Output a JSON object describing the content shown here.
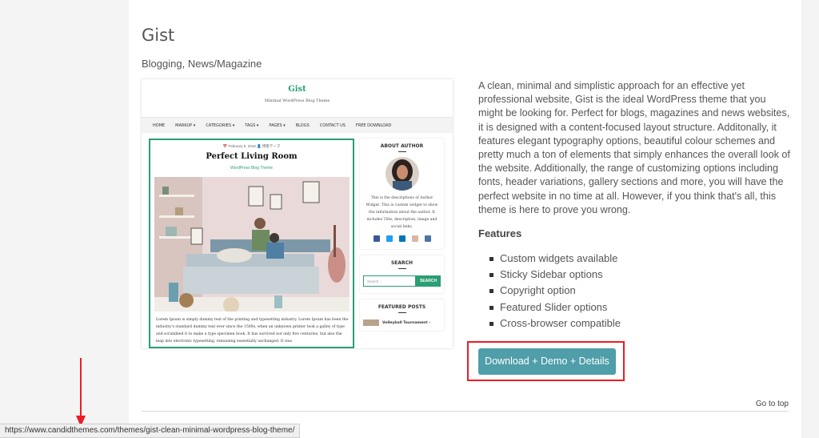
{
  "theme": {
    "title": "Gist",
    "categories": "Blogging, News/Magazine"
  },
  "preview": {
    "site_title": "Gist",
    "tagline": "Minimal WordPress Blog Theme",
    "nav": [
      "HOME",
      "MARKUP ▾",
      "CATEGORIES ▾",
      "TAGS ▾",
      "PAGES ▾",
      "BLOGS",
      "CONTACT US",
      "FREE DOWNLOAD"
    ],
    "post_meta": "📅 February 5, 2018   👤 博客テーマ",
    "post_title": "Perfect Living Room",
    "post_category": "WordPress Blog Theme",
    "post_excerpt": "Lorem Ipsum is simply dummy text of the printing and typesetting industry. Lorem Ipsum has been the industry's standard dummy text ever since the 1500s, when an unknown printer took a galley of type and scrambled it to make a type specimen book. It has survived not only five centuries, but also the leap into electronic typesetting, remaining essentially unchanged. It was",
    "about_title": "ABOUT AUTHOR",
    "about_text": "This is the descriptions of Author Widget. This is custom widget to show the information about the author. It includes Title, description, image and social links.",
    "search_title": "SEARCH",
    "search_placeholder": "Search ...",
    "search_button": "SEARCH",
    "featured_title": "FEATURED POSTS",
    "featured_item": "Volleyball Tournament –"
  },
  "description": "A clean, minimal and simplistic approach for an effective yet professional website, Gist is the ideal WordPress theme that you might be looking for. Perfect for blogs, magazines and news websites, it is designed with a content-focused layout structure. Additonally, it features elegant typography options, beautiful colour schemes and pretty much a ton of elements that simply enhances the overall look of the website. Additionally, the range of customizing options including fonts, header variations, gallery sections and more, you will have the perfect website in no time at all. However, if you think that's all, this theme is here to prove you wrong.",
  "features": {
    "heading": "Features",
    "items": [
      "Custom widgets available",
      "Sticky Sidebar options",
      "Copyright option",
      "Featured Slider options",
      "Cross-browser compatible"
    ]
  },
  "download_button": "Download + Demo + Details",
  "go_top": "Go to top",
  "status_url": "https://www.candidthemes.com/themes/gist-clean-minimal-wordpress-blog-theme/",
  "colors": {
    "accent_green": "#2a9e74",
    "button_teal": "#4f9ea9",
    "highlight_red": "#ec1c24"
  },
  "social_icons": [
    "facebook-icon",
    "twitter-icon",
    "linkedin-icon",
    "instagram-icon",
    "vk-icon"
  ]
}
